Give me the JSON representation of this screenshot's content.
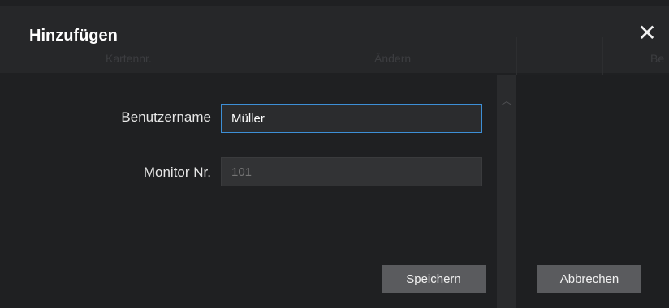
{
  "dialog": {
    "title": "Hinzufügen",
    "close_icon": "close-icon"
  },
  "background_table": {
    "headers": [
      "Kartennr.",
      "Ändern",
      "Be"
    ]
  },
  "form": {
    "username_label": "Benutzername",
    "username_value": "Müller",
    "monitor_label": "Monitor Nr.",
    "monitor_placeholder": "101"
  },
  "buttons": {
    "save_label": "Speichern",
    "cancel_label": "Abbrechen"
  },
  "colors": {
    "accent_focus": "#3d8fd6",
    "button_bg": "#5a5b5e",
    "dialog_bg": "#1f2022"
  }
}
